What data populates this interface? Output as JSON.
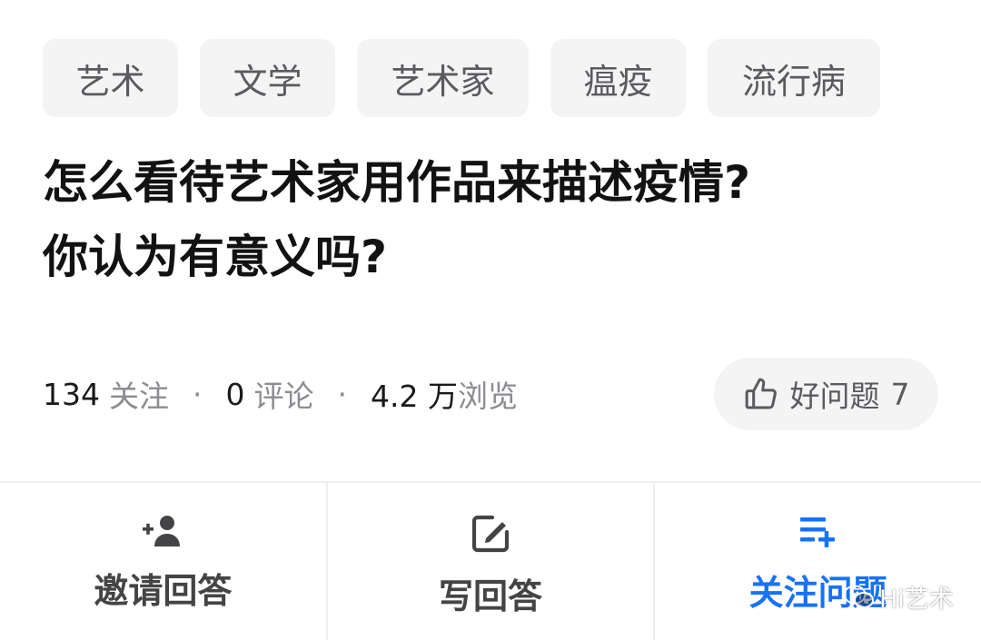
{
  "tags": [
    "艺术",
    "文学",
    "艺术家",
    "瘟疫",
    "流行病"
  ],
  "question": {
    "title_line1": "怎么看待艺术家用作品来描述疫情?",
    "title_line2": "你认为有意义吗?"
  },
  "stats": {
    "follow_count": "134",
    "follow_label": "关注",
    "comment_count": "0",
    "comment_label": "评论",
    "view_count": "4.2 万",
    "view_label": "浏览",
    "separator": "·"
  },
  "good_question": {
    "label": "好问题",
    "count": "7"
  },
  "actions": {
    "invite": "邀请回答",
    "write": "写回答",
    "follow": "关注问题"
  },
  "watermark": "Hi艺术",
  "colors": {
    "accent": "#1772f6",
    "tag_bg": "#f4f4f5",
    "muted_text": "#8c8c91",
    "title_text": "#121212"
  },
  "icons": {
    "good_question": "thumbs-up-icon",
    "invite": "add-person-icon",
    "write": "edit-icon",
    "follow": "playlist-add-icon",
    "watermark": "wechat-icon"
  }
}
